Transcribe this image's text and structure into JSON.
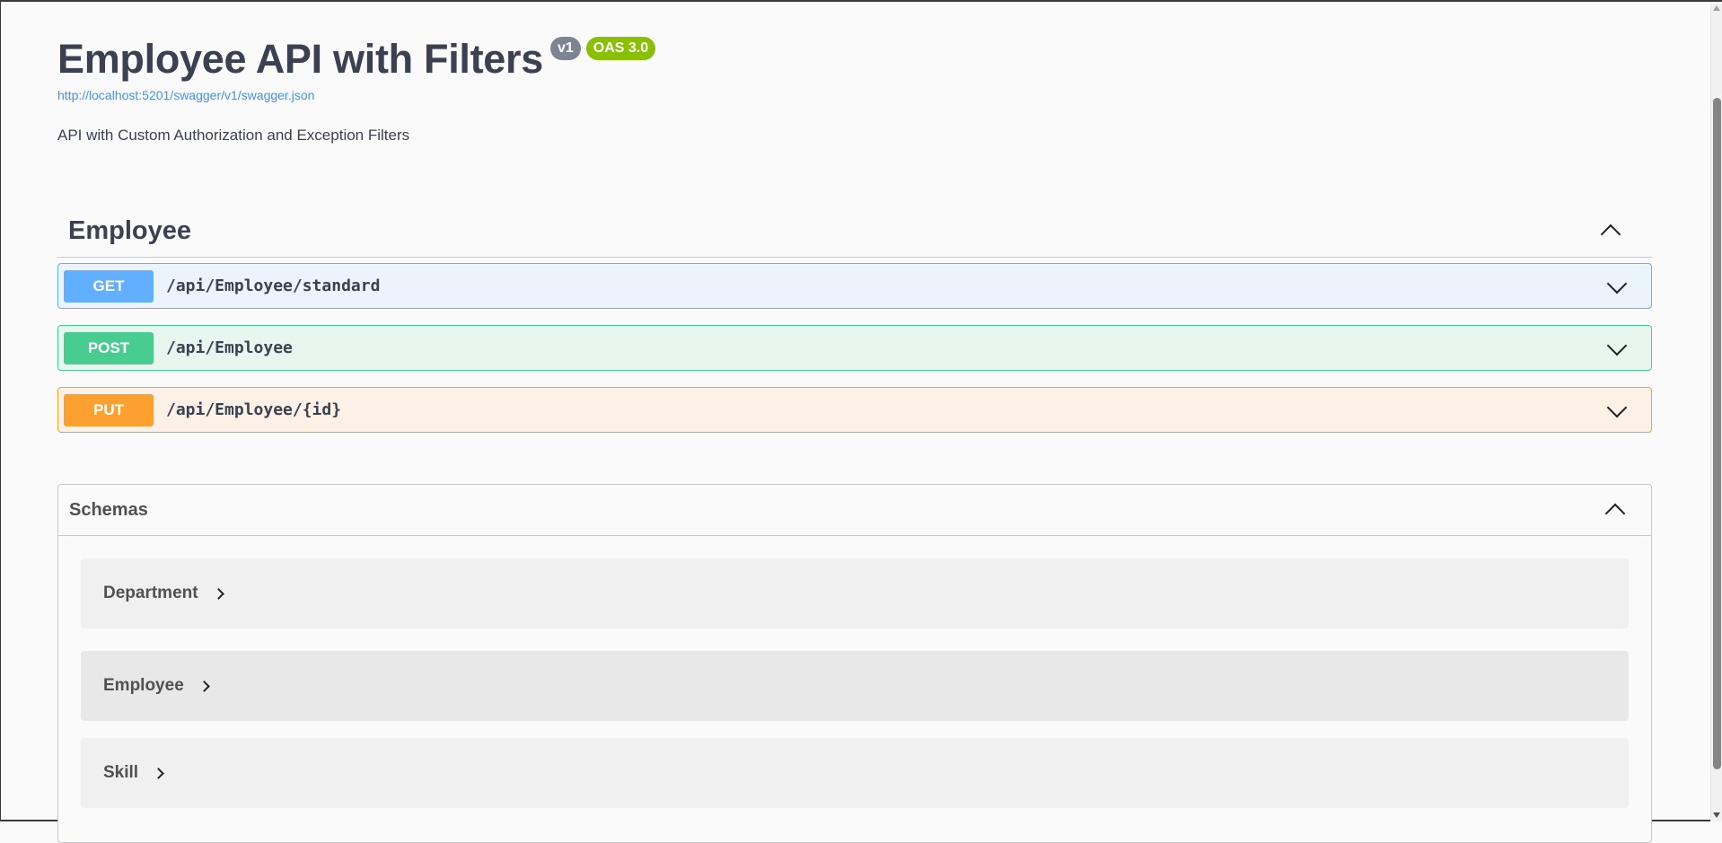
{
  "info": {
    "title": "Employee API with Filters",
    "version_badge": "v1",
    "oas_badge": "OAS 3.0",
    "spec_url": "http://localhost:5201/swagger/v1/swagger.json",
    "description": "API with Custom Authorization and Exception Filters"
  },
  "tag": {
    "name": "Employee",
    "operations": [
      {
        "method": "GET",
        "path": "/api/Employee/standard"
      },
      {
        "method": "POST",
        "path": "/api/Employee"
      },
      {
        "method": "PUT",
        "path": "/api/Employee/{id}"
      }
    ]
  },
  "schemas": {
    "title": "Schemas",
    "models": [
      "Department",
      "Employee",
      "Skill"
    ]
  },
  "colors": {
    "get": "#61affe",
    "post": "#49cc90",
    "put": "#fca130",
    "oas_badge": "#89bf04",
    "version_badge": "#7d8492",
    "link": "#4990e2"
  }
}
